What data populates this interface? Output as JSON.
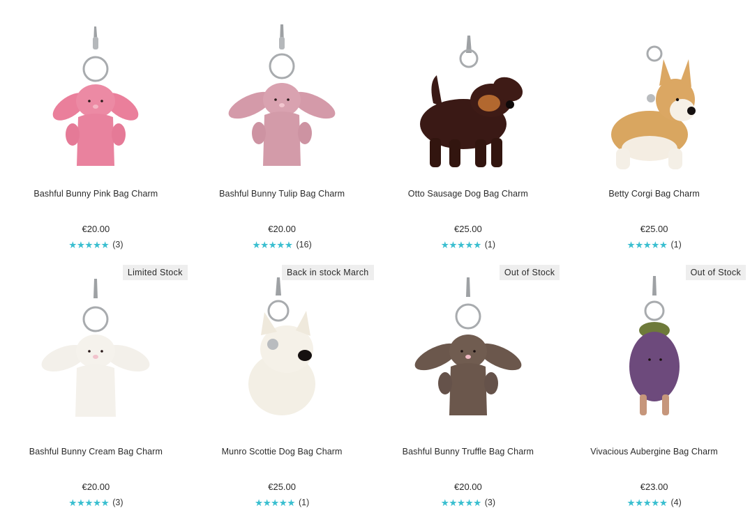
{
  "products": [
    {
      "name": "Bashful Bunny Pink Bag Charm",
      "price": "€20.00",
      "stars": "★★★★★",
      "reviews": "(3)",
      "badge": "",
      "icon": "pink-bunny-charm-image",
      "color": "#e97d9a"
    },
    {
      "name": "Bashful Bunny Tulip Bag Charm",
      "price": "€20.00",
      "stars": "★★★★★",
      "reviews": "(16)",
      "badge": "",
      "icon": "tulip-bunny-charm-image",
      "color": "#d19aa6"
    },
    {
      "name": "Otto Sausage Dog Bag Charm",
      "price": "€25.00",
      "stars": "★★★★★",
      "reviews": "(1)",
      "badge": "",
      "icon": "sausage-dog-charm-image",
      "color": "#3b1a16"
    },
    {
      "name": "Betty Corgi Bag Charm",
      "price": "€25.00",
      "stars": "★★★★★",
      "reviews": "(1)",
      "badge": "",
      "icon": "corgi-charm-image",
      "color": "#d9a761"
    },
    {
      "name": "Bashful Bunny Cream Bag Charm",
      "price": "€20.00",
      "stars": "★★★★★",
      "reviews": "(3)",
      "badge": "Limited Stock",
      "icon": "cream-bunny-charm-image",
      "color": "#f2efe9"
    },
    {
      "name": "Munro Scottie Dog Bag Charm",
      "price": "€25.00",
      "stars": "★★★★★",
      "reviews": "(1)",
      "badge": "Back in stock March",
      "icon": "scottie-dog-charm-image",
      "color": "#f3efe6"
    },
    {
      "name": "Bashful Bunny Truffle Bag Charm",
      "price": "€20.00",
      "stars": "★★★★★",
      "reviews": "(3)",
      "badge": "Out of Stock",
      "icon": "truffle-bunny-charm-image",
      "color": "#6e5a4f"
    },
    {
      "name": "Vivacious Aubergine Bag Charm",
      "price": "€23.00",
      "stars": "★★★★★",
      "reviews": "(4)",
      "badge": "Out of Stock",
      "icon": "aubergine-charm-image",
      "color": "#6e4a7c"
    }
  ],
  "rating_color": "#3bbfd0"
}
